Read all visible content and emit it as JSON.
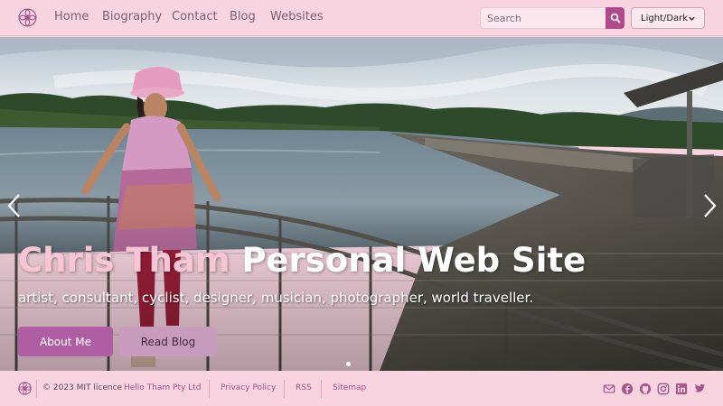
{
  "nav": {
    "logo_icon": "flower-icon",
    "links": [
      "Home",
      "Biography",
      "Contact",
      "Blog",
      "Websites"
    ],
    "search_placeholder": "Search",
    "search_icon": "search-icon",
    "theme_label": "Light/Dark"
  },
  "hero": {
    "title_accent": "Chris Tham",
    "title_rest": " Personal Web Site",
    "subtitle": "artist, consultant, cyclist, designer, musician, photographer, world traveller.",
    "about_button": "About Me",
    "blog_button": "Read Blog",
    "prev_icon": "chevron-left-icon",
    "next_icon": "chevron-right-icon"
  },
  "footer": {
    "copyright": "© 2023 MIT licence",
    "company": "Hello Tham Pty Ltd",
    "links": [
      "Privacy Policy",
      "RSS",
      "Sitemap"
    ],
    "social_icons": [
      "email-icon",
      "facebook-icon",
      "github-icon",
      "instagram-icon",
      "linkedin-icon",
      "twitter-icon"
    ]
  },
  "colors": {
    "background": "#f7d4e0",
    "accent": "#b04a8d",
    "button_primary": "#b05ea3",
    "button_secondary": "#c69bbd",
    "link": "#a2508a",
    "title_accent": "#f7c5d3"
  }
}
